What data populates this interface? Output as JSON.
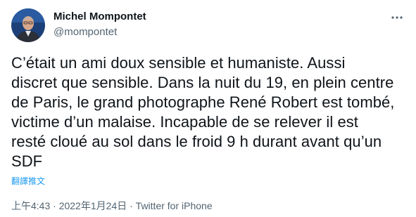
{
  "author": {
    "name": "Michel Mompontet",
    "handle": "@mompontet",
    "avatar_icon": "profile-photo"
  },
  "menu": {
    "more_icon": "more-horizontal-icon"
  },
  "tweet": {
    "text": "C’était un ami doux sensible et humaniste. Aussi\ndiscret que sensible. Dans la nuit du 19, en plein centre\nde Paris, le grand photographe René Robert est tombé,\nvictime d’un malaise. Incapable de se relever il est\nresté cloué au sol dans le froid 9 h durant avant qu’un\nSDF",
    "translate_label": "翻譯推文"
  },
  "meta": {
    "time": "上午4:43",
    "separator": " · ",
    "date": "2022年1月24日",
    "source": "Twitter for iPhone"
  },
  "colors": {
    "text": "#0f1419",
    "secondary": "#536471",
    "link": "#1d9bf0"
  }
}
